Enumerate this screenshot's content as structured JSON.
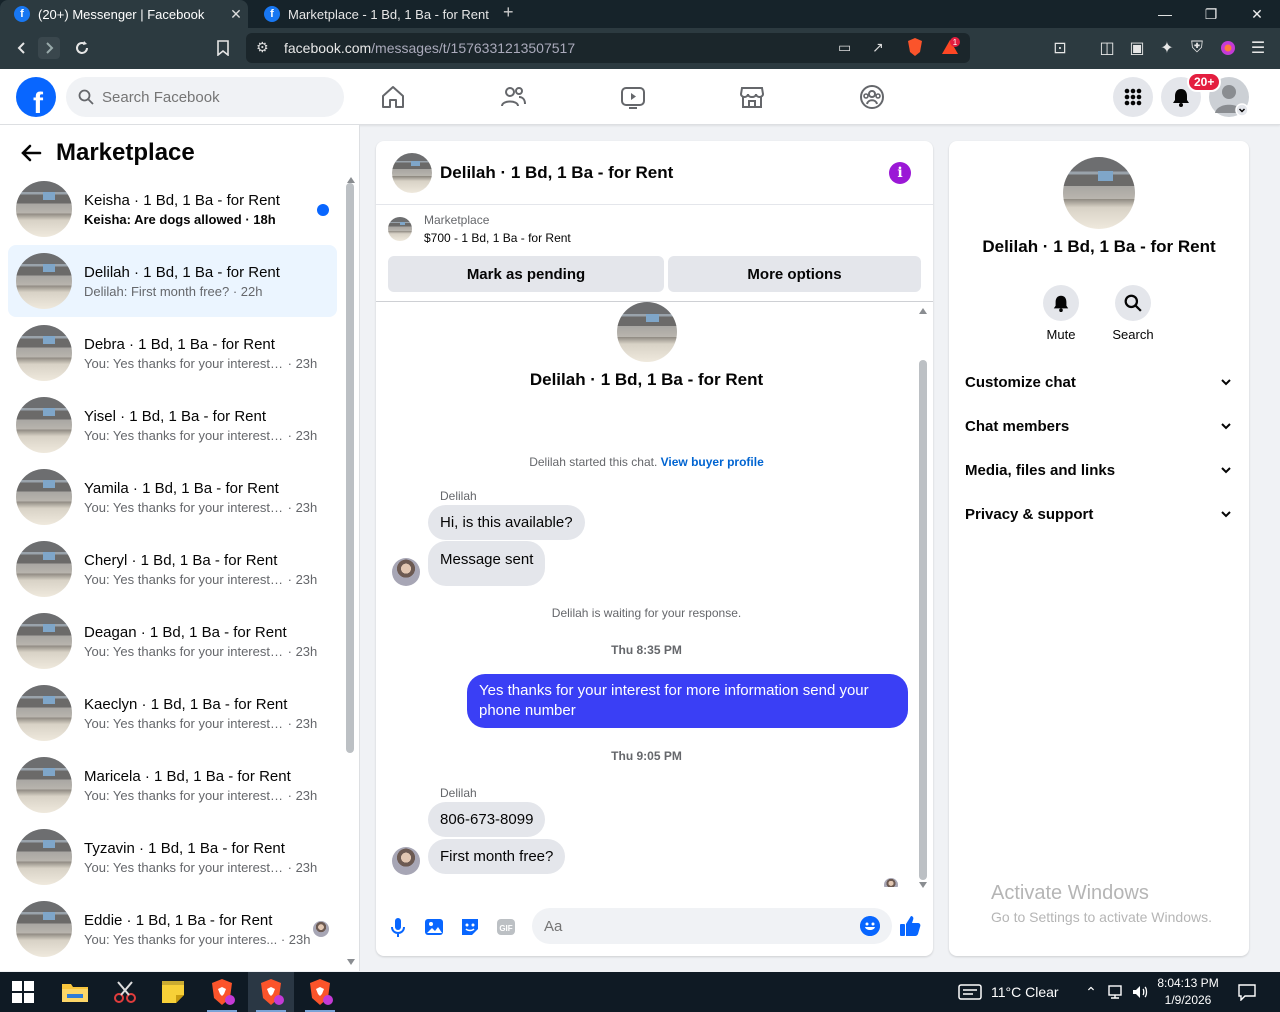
{
  "browser": {
    "tabs": [
      {
        "title": "(20+) Messenger | Facebook",
        "close": "✕"
      },
      {
        "title": "Marketplace - 1 Bd, 1 Ba - for Rent"
      }
    ],
    "new_tab": "+",
    "url_host": "facebook.com",
    "url_path": "/messages/t/1576331213507517",
    "brave_badge": "1"
  },
  "fb": {
    "logo": "f",
    "search_placeholder": "Search Facebook",
    "notif_badge": "20+"
  },
  "left": {
    "title": "Marketplace",
    "conversations": [
      {
        "name": "Keisha · 1 Bd, 1 Ba - for Rent",
        "preview": "Keisha: Are dogs allowed",
        "time": "· 18h",
        "unread": true
      },
      {
        "name": "Delilah · 1 Bd, 1 Ba - for Rent",
        "preview": "Delilah: First month free?",
        "time": "· 22h",
        "selected": true
      },
      {
        "name": "Debra · 1 Bd, 1 Ba - for Rent",
        "preview": "You: Yes thanks for your interest f...",
        "time": "· 23h"
      },
      {
        "name": "Yisel · 1 Bd, 1 Ba - for Rent",
        "preview": "You: Yes thanks for your interest f...",
        "time": "· 23h"
      },
      {
        "name": "Yamila · 1 Bd, 1 Ba - for Rent",
        "preview": "You: Yes thanks for your interest f...",
        "time": "· 23h"
      },
      {
        "name": "Cheryl · 1 Bd, 1 Ba - for Rent",
        "preview": "You: Yes thanks for your interest f...",
        "time": "· 23h"
      },
      {
        "name": "Deagan · 1 Bd, 1 Ba - for Rent",
        "preview": "You: Yes thanks for your interest f...",
        "time": "· 23h"
      },
      {
        "name": "Kaeclyn · 1 Bd, 1 Ba - for Rent",
        "preview": "You: Yes thanks for your interest f...",
        "time": "· 23h"
      },
      {
        "name": "Maricela · 1 Bd, 1 Ba - for Rent",
        "preview": "You: Yes thanks for your interest f...",
        "time": "· 23h"
      },
      {
        "name": "Tyzavin · 1 Bd, 1 Ba - for Rent",
        "preview": "You: Yes thanks for your interest f...",
        "time": "· 23h"
      },
      {
        "name": "Eddie · 1 Bd, 1 Ba - for Rent",
        "preview": "You: Yes thanks for your interes...",
        "time": "· 23h"
      }
    ]
  },
  "chat": {
    "title": "Delilah · 1 Bd, 1 Ba - for Rent",
    "marketplace_label": "Marketplace",
    "listing": "$700 - 1 Bd, 1 Ba - for Rent",
    "mark_pending": "Mark as pending",
    "more_options": "More options",
    "center_name": "Delilah · 1 Bd, 1 Ba - for Rent",
    "started": "Delilah started this chat.",
    "view_buyer": "View buyer profile",
    "sender1": "Delilah",
    "msg1": "Hi, is this available?",
    "msg2": "Message sent",
    "waiting": "Delilah is waiting for your response.",
    "time1": "Thu 8:35 PM",
    "out_msg": "Yes thanks for your interest for more information send your phone number",
    "time2": "Thu 9:05 PM",
    "sender2": "Delilah",
    "msg3": "806-673-8099",
    "msg4": "First month free?",
    "composer_placeholder": "Aa",
    "gif_label": "GIF"
  },
  "right": {
    "name": "Delilah · 1 Bd, 1 Ba - for Rent",
    "mute": "Mute",
    "search": "Search",
    "items": [
      "Customize chat",
      "Chat members",
      "Media, files and links",
      "Privacy & support"
    ]
  },
  "watermark": {
    "line1": "Activate Windows",
    "line2": "Go to Settings to activate Windows."
  },
  "taskbar": {
    "weather": "11°C  Clear",
    "time": "8:04:13 PM",
    "date": "1/9/2026"
  },
  "colors": {
    "fb_blue": "#0866ff",
    "out_bubble": "#3a3ff5",
    "selected_row": "#ebf5ff",
    "info_purple": "#9b18d6",
    "notif_red": "#e41e3f"
  }
}
